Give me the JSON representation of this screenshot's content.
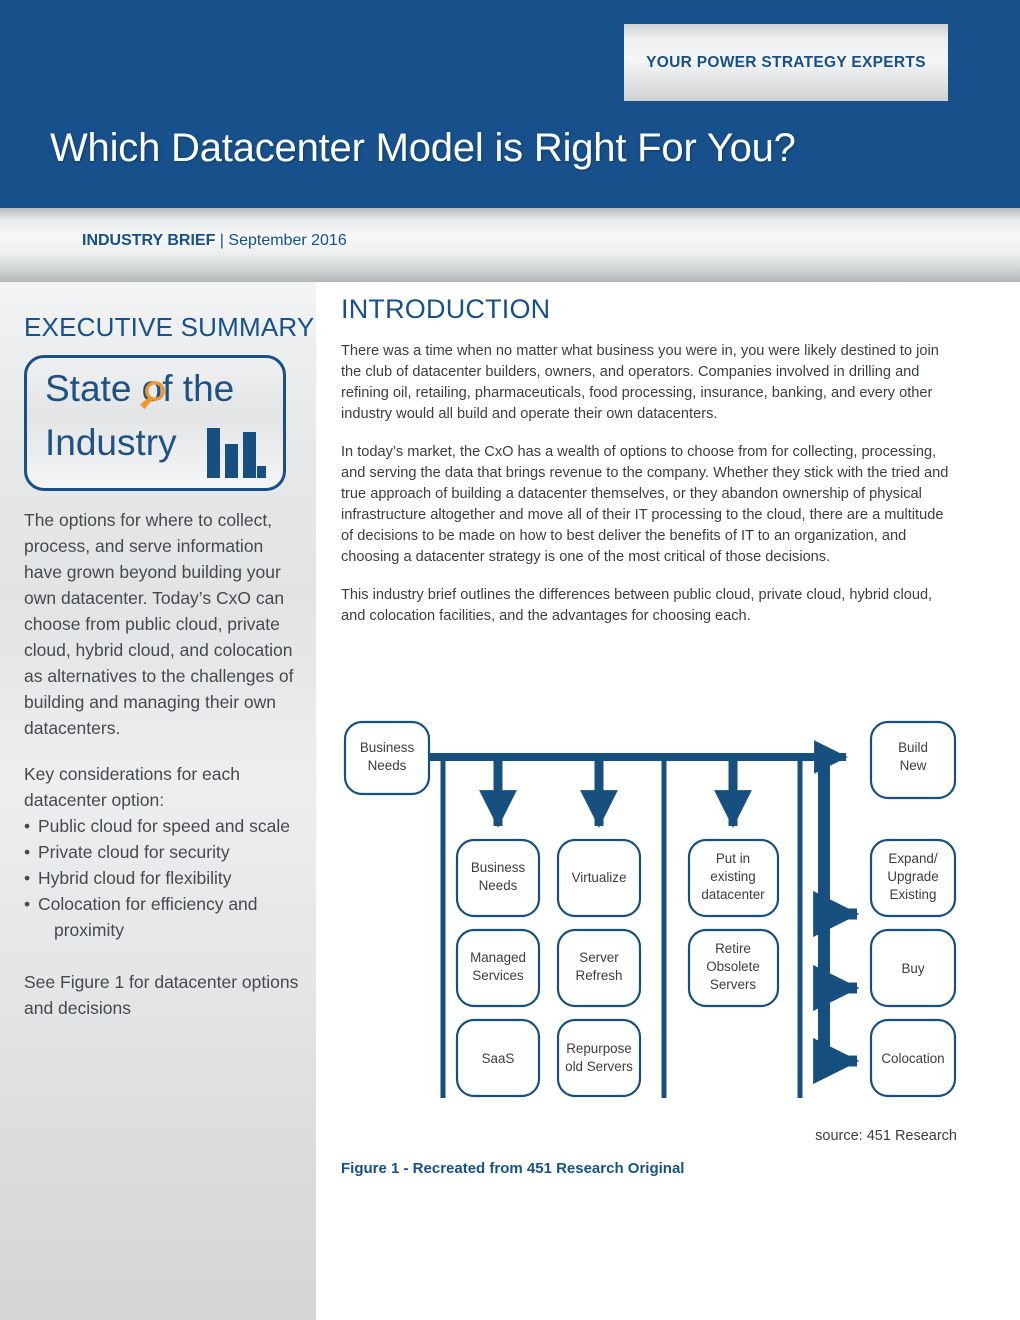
{
  "header": {
    "tagline": "YOUR POWER STRATEGY EXPERTS",
    "title": "Which Datacenter Model is Right For You?",
    "meta_label": "INDUSTRY BRIEF",
    "meta_separator": "|",
    "meta_date": "September 2016",
    "brand_blue": "#17508b",
    "accent_orange": "#f0962b"
  },
  "sidebar": {
    "heading": "EXECUTIVE SUMMARY",
    "logo": {
      "line1": "State of the",
      "line2": "Industry",
      "loupe_icon": "magnifying-glass-icon",
      "chart_icon": "bar-chart-icon"
    },
    "paragraph": "The options for where to collect, process, and serve information have grown beyond building your own datacenter. Today’s CxO can choose from public cloud, private cloud, hybrid cloud, and colocation as alternatives to the challenges of building and managing their own datacenters.",
    "considerations_intro_line1": "Key considerations for each",
    "considerations_intro_line2": "datacenter option:",
    "considerations": [
      "Public cloud for speed and scale",
      "Private cloud for security",
      "Hybrid cloud for flexibility",
      "Colocation for efficiency and"
    ],
    "considerations_last_continuation": "proximity",
    "figure_ref_line1": "See Figure 1 for datacenter options",
    "figure_ref_line2": "and decisions"
  },
  "main": {
    "heading": "INTRODUCTION",
    "paragraphs": [
      "There was a time when no matter what business you were in, you were likely destined to join the club of datacenter builders, owners, and operators. Companies involved in drilling and refining oil, retailing, pharmaceuticals, food processing, insurance, banking, and every other industry would all build and operate their own datacenters.",
      "In today’s market, the CxO has a wealth of options to choose from for collecting, processing, and serving the data that brings revenue to the company. Whether they stick with the tried and true approach of building a datacenter themselves, or they abandon ownership of physical infrastructure altogether and move all of their IT processing to the cloud, there are a multitude of decisions to be made on how to best deliver the benefits of IT to an organization, and choosing a datacenter strategy is one of the most critical of those decisions.",
      "This industry brief outlines the differences between public cloud, private cloud, hybrid cloud, and colocation facilities, and the advantages for choosing each."
    ]
  },
  "figure": {
    "source": "source: 451 Research",
    "caption": "Figure 1 - Recreated from 451 Research Original",
    "line_color": "#17507f",
    "nodes": {
      "start": [
        "Business",
        "Needs"
      ],
      "col1": [
        [
          "Business",
          "Needs"
        ],
        [
          "Managed",
          "Services"
        ],
        [
          "SaaS"
        ]
      ],
      "col2": [
        [
          "Virtualize"
        ],
        [
          "Server",
          "Refresh"
        ],
        [
          "Repurpose",
          "old Servers"
        ]
      ],
      "col3": [
        [
          "Put in",
          "existing",
          "datacenter"
        ],
        [
          "Retire",
          "Obsolete",
          "Servers"
        ]
      ],
      "col4": [
        [
          "Build",
          "New"
        ],
        [
          "Expand/",
          "Upgrade",
          "Existing"
        ],
        [
          "Buy"
        ],
        [
          "Colocation"
        ]
      ]
    }
  }
}
